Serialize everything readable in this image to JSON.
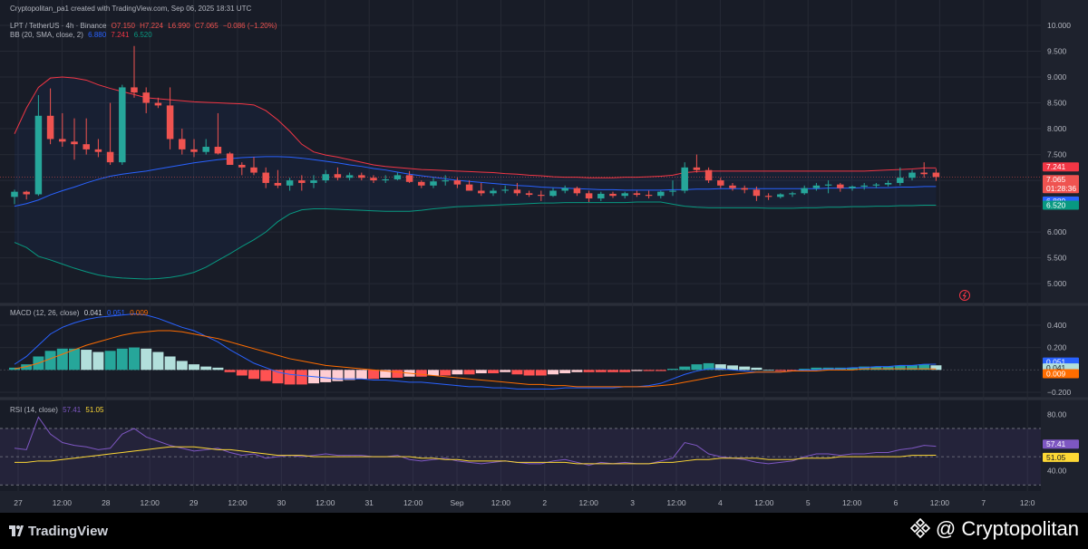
{
  "header": {
    "credit": "Cryptopolitan_pa1 created with TradingView.com, Sep 06, 2025 18:31 UTC",
    "symbol": "LPT / TetherUS · 4h · Binance",
    "ohlc": {
      "open": "O7.150",
      "high": "H7.224",
      "low": "L6.990",
      "close": "C7.065",
      "change": "−0.086 (−1.20%)"
    },
    "bb_label": "BB (20, SMA, close, 2)",
    "bb_values": [
      "6.880",
      "7.241",
      "6.520"
    ],
    "macd_label": "MACD (12, 26, close)",
    "macd_values": [
      "0.041",
      "0.051",
      "0.009"
    ],
    "rsi_label": "RSI (14, close)",
    "rsi_values": [
      "57.41",
      "51.05"
    ]
  },
  "badges": {
    "price_upper": "7.241",
    "price_last": "7.065",
    "countdown": "01:28:36",
    "price_mid": "6.880",
    "price_lower": "6.520",
    "macd_signal": "0.051",
    "macd_value": "0.041",
    "macd_hist": "0.009",
    "rsi_value": "57.41",
    "rsi_ma": "51.05"
  },
  "footer": {
    "brand": "TradingView",
    "watermark": "@ Cryptopolitan"
  },
  "colors": {
    "up": "#26a69a",
    "down": "#ef5350",
    "bb_upper": "#f23645",
    "bb_basis": "#2962ff",
    "bb_lower": "#089981",
    "macd_line": "#2962ff",
    "macd_signal": "#ff6d00",
    "rsi_line": "#7e57c2",
    "rsi_ma": "#fdd835"
  },
  "chart_data": [
    {
      "type": "candlestick",
      "x_ticks": [
        "27",
        "12:00",
        "28",
        "12:00",
        "29",
        "12:00",
        "30",
        "12:00",
        "31",
        "12:00",
        "Sep",
        "12:00",
        "2",
        "12:00",
        "3",
        "12:00",
        "4",
        "12:00",
        "5",
        "12:00",
        "6",
        "12:00",
        "7",
        "12:0"
      ],
      "y_ticks": [
        "10.000",
        "9.500",
        "9.000",
        "8.500",
        "8.000",
        "7.500",
        "7.000",
        "6.500",
        "6.000",
        "5.500",
        "5.000"
      ],
      "ylim": [
        4.95,
        10.0
      ],
      "ohlc": [
        [
          6.68,
          6.82,
          6.54,
          6.78
        ],
        [
          6.78,
          6.8,
          6.63,
          6.73
        ],
        [
          6.73,
          8.65,
          6.7,
          8.25
        ],
        [
          8.25,
          8.78,
          7.7,
          7.8
        ],
        [
          7.8,
          8.3,
          7.65,
          7.75
        ],
        [
          7.75,
          8.2,
          7.4,
          7.7
        ],
        [
          7.7,
          8.2,
          7.5,
          7.6
        ],
        [
          7.6,
          7.8,
          7.45,
          7.55
        ],
        [
          7.55,
          8.5,
          7.3,
          7.35
        ],
        [
          7.35,
          8.85,
          7.3,
          8.8
        ],
        [
          8.8,
          9.6,
          8.6,
          8.7
        ],
        [
          8.7,
          8.8,
          8.3,
          8.5
        ],
        [
          8.5,
          8.6,
          8.4,
          8.45
        ],
        [
          8.45,
          8.8,
          7.6,
          7.8
        ],
        [
          7.8,
          8.0,
          7.5,
          7.6
        ],
        [
          7.6,
          7.8,
          7.45,
          7.55
        ],
        [
          7.55,
          7.8,
          7.5,
          7.65
        ],
        [
          7.65,
          8.3,
          7.5,
          7.52
        ],
        [
          7.52,
          7.55,
          7.3,
          7.3
        ],
        [
          7.3,
          7.35,
          7.1,
          7.25
        ],
        [
          7.25,
          7.45,
          7.1,
          7.15
        ],
        [
          7.15,
          7.25,
          6.85,
          6.95
        ],
        [
          6.95,
          7.2,
          6.85,
          6.9
        ],
        [
          6.9,
          7.05,
          6.8,
          7.0
        ],
        [
          7.0,
          7.1,
          6.8,
          6.95
        ],
        [
          6.95,
          7.1,
          6.85,
          7.0
        ],
        [
          7.0,
          7.2,
          6.95,
          7.12
        ],
        [
          7.12,
          7.25,
          7.0,
          7.05
        ],
        [
          7.05,
          7.15,
          7.0,
          7.1
        ],
        [
          7.1,
          7.15,
          7.0,
          7.05
        ],
        [
          7.05,
          7.1,
          6.95,
          7.0
        ],
        [
          7.0,
          7.1,
          6.95,
          7.02
        ],
        [
          7.02,
          7.15,
          7.0,
          7.1
        ],
        [
          7.1,
          7.18,
          6.95,
          6.97
        ],
        [
          6.97,
          7.0,
          6.85,
          6.9
        ],
        [
          6.9,
          7.05,
          6.85,
          6.98
        ],
        [
          6.98,
          7.1,
          6.9,
          7.0
        ],
        [
          7.0,
          7.05,
          6.85,
          6.92
        ],
        [
          6.92,
          7.0,
          6.8,
          6.8
        ],
        [
          6.8,
          6.95,
          6.7,
          6.75
        ],
        [
          6.75,
          6.85,
          6.7,
          6.8
        ],
        [
          6.8,
          6.9,
          6.75,
          6.82
        ],
        [
          6.82,
          6.95,
          6.7,
          6.75
        ],
        [
          6.75,
          6.8,
          6.68,
          6.72
        ],
        [
          6.72,
          6.8,
          6.6,
          6.7
        ],
        [
          6.7,
          6.85,
          6.68,
          6.8
        ],
        [
          6.8,
          6.9,
          6.75,
          6.85
        ],
        [
          6.85,
          6.88,
          6.7,
          6.75
        ],
        [
          6.75,
          6.8,
          6.58,
          6.65
        ],
        [
          6.65,
          6.78,
          6.6,
          6.74
        ],
        [
          6.74,
          6.78,
          6.66,
          6.7
        ],
        [
          6.7,
          6.78,
          6.65,
          6.75
        ],
        [
          6.75,
          6.8,
          6.68,
          6.72
        ],
        [
          6.72,
          6.8,
          6.65,
          6.7
        ],
        [
          6.7,
          6.8,
          6.65,
          6.78
        ],
        [
          6.78,
          7.0,
          6.7,
          6.8
        ],
        [
          6.8,
          7.35,
          6.75,
          7.25
        ],
        [
          7.25,
          7.5,
          7.15,
          7.2
        ],
        [
          7.2,
          7.25,
          6.95,
          7.0
        ],
        [
          7.0,
          7.05,
          6.85,
          6.9
        ],
        [
          6.9,
          6.95,
          6.8,
          6.85
        ],
        [
          6.85,
          6.9,
          6.75,
          6.82
        ],
        [
          6.82,
          6.88,
          6.6,
          6.7
        ],
        [
          6.7,
          6.75,
          6.62,
          6.68
        ],
        [
          6.68,
          6.75,
          6.65,
          6.73
        ],
        [
          6.73,
          6.78,
          6.68,
          6.75
        ],
        [
          6.75,
          6.9,
          6.72,
          6.85
        ],
        [
          6.85,
          6.95,
          6.8,
          6.9
        ],
        [
          6.9,
          7.0,
          6.75,
          6.92
        ],
        [
          6.92,
          6.95,
          6.78,
          6.85
        ],
        [
          6.85,
          6.9,
          6.8,
          6.88
        ],
        [
          6.88,
          6.95,
          6.82,
          6.9
        ],
        [
          6.9,
          6.95,
          6.85,
          6.92
        ],
        [
          6.92,
          7.0,
          6.88,
          6.95
        ],
        [
          6.95,
          7.25,
          6.9,
          7.05
        ],
        [
          7.05,
          7.2,
          7.0,
          7.15
        ],
        [
          7.15,
          7.35,
          7.05,
          7.12
        ],
        [
          7.15,
          7.224,
          6.99,
          7.065
        ]
      ],
      "bb_upper": [
        7.9,
        8.4,
        8.8,
        8.98,
        9.0,
        8.98,
        8.94,
        8.85,
        8.78,
        8.72,
        8.66,
        8.6,
        8.58,
        8.56,
        8.54,
        8.52,
        8.51,
        8.5,
        8.49,
        8.48,
        8.46,
        8.35,
        8.17,
        7.95,
        7.7,
        7.55,
        7.49,
        7.45,
        7.4,
        7.35,
        7.3,
        7.27,
        7.25,
        7.23,
        7.21,
        7.2,
        7.19,
        7.18,
        7.17,
        7.16,
        7.15,
        7.13,
        7.12,
        7.1,
        7.09,
        7.07,
        7.06,
        7.06,
        7.05,
        7.05,
        7.05,
        7.06,
        7.06,
        7.07,
        7.08,
        7.1,
        7.15,
        7.17,
        7.18,
        7.18,
        7.18,
        7.18,
        7.18,
        7.18,
        7.18,
        7.18,
        7.18,
        7.18,
        7.18,
        7.18,
        7.18,
        7.18,
        7.19,
        7.2,
        7.21,
        7.22,
        7.24,
        7.241
      ],
      "bb_basis": [
        6.5,
        6.55,
        6.62,
        6.72,
        6.8,
        6.87,
        6.95,
        7.02,
        7.08,
        7.12,
        7.15,
        7.18,
        7.22,
        7.26,
        7.3,
        7.34,
        7.37,
        7.4,
        7.42,
        7.44,
        7.45,
        7.46,
        7.46,
        7.45,
        7.43,
        7.4,
        7.37,
        7.34,
        7.3,
        7.27,
        7.23,
        7.2,
        7.16,
        7.12,
        7.09,
        7.06,
        7.03,
        7.0,
        6.98,
        6.96,
        6.94,
        6.92,
        6.9,
        6.89,
        6.87,
        6.86,
        6.85,
        6.84,
        6.83,
        6.82,
        6.82,
        6.81,
        6.81,
        6.81,
        6.81,
        6.82,
        6.82,
        6.83,
        6.83,
        6.84,
        6.84,
        6.84,
        6.84,
        6.84,
        6.84,
        6.84,
        6.84,
        6.84,
        6.85,
        6.85,
        6.85,
        6.86,
        6.86,
        6.86,
        6.87,
        6.87,
        6.88,
        6.88
      ],
      "bb_lower": [
        5.8,
        5.7,
        5.53,
        5.46,
        5.38,
        5.3,
        5.23,
        5.17,
        5.13,
        5.11,
        5.1,
        5.09,
        5.1,
        5.12,
        5.16,
        5.22,
        5.32,
        5.45,
        5.58,
        5.72,
        5.85,
        6.0,
        6.2,
        6.35,
        6.43,
        6.45,
        6.45,
        6.44,
        6.43,
        6.42,
        6.41,
        6.4,
        6.4,
        6.4,
        6.42,
        6.45,
        6.47,
        6.49,
        6.5,
        6.51,
        6.52,
        6.53,
        6.54,
        6.55,
        6.56,
        6.56,
        6.57,
        6.57,
        6.57,
        6.57,
        6.57,
        6.57,
        6.58,
        6.58,
        6.58,
        6.54,
        6.5,
        6.48,
        6.47,
        6.47,
        6.47,
        6.47,
        6.47,
        6.46,
        6.46,
        6.46,
        6.47,
        6.47,
        6.48,
        6.48,
        6.49,
        6.49,
        6.5,
        6.5,
        6.51,
        6.51,
        6.52,
        6.52
      ]
    },
    {
      "type": "macd",
      "y_ticks": [
        "0.400",
        "0.200",
        "−0.200"
      ],
      "ylim": [
        -0.24,
        0.52
      ],
      "histogram": [
        0.02,
        0.05,
        0.12,
        0.17,
        0.19,
        0.19,
        0.18,
        0.16,
        0.17,
        0.19,
        0.2,
        0.19,
        0.16,
        0.12,
        0.08,
        0.05,
        0.03,
        0.02,
        -0.02,
        -0.05,
        -0.08,
        -0.1,
        -0.12,
        -0.13,
        -0.13,
        -0.12,
        -0.11,
        -0.1,
        -0.09,
        -0.08,
        -0.08,
        -0.07,
        -0.07,
        -0.06,
        -0.06,
        -0.05,
        -0.05,
        -0.04,
        -0.04,
        -0.03,
        -0.03,
        -0.02,
        -0.04,
        -0.05,
        -0.05,
        -0.04,
        -0.03,
        -0.02,
        -0.02,
        -0.02,
        -0.02,
        -0.02,
        -0.01,
        -0.01,
        -0.01,
        0.01,
        0.03,
        0.05,
        0.06,
        0.05,
        0.04,
        0.03,
        0.02,
        0.0,
        -0.01,
        -0.01,
        0.01,
        0.02,
        0.02,
        0.02,
        0.02,
        0.03,
        0.03,
        0.03,
        0.04,
        0.04,
        0.05,
        0.041
      ],
      "macd": [
        0.05,
        0.12,
        0.22,
        0.32,
        0.38,
        0.42,
        0.45,
        0.47,
        0.48,
        0.49,
        0.5,
        0.49,
        0.46,
        0.42,
        0.38,
        0.35,
        0.3,
        0.25,
        0.18,
        0.12,
        0.06,
        0.02,
        -0.02,
        -0.04,
        -0.05,
        -0.06,
        -0.07,
        -0.08,
        -0.08,
        -0.08,
        -0.09,
        -0.09,
        -0.1,
        -0.11,
        -0.11,
        -0.12,
        -0.13,
        -0.14,
        -0.15,
        -0.15,
        -0.16,
        -0.16,
        -0.17,
        -0.17,
        -0.17,
        -0.17,
        -0.16,
        -0.16,
        -0.16,
        -0.16,
        -0.16,
        -0.15,
        -0.15,
        -0.14,
        -0.12,
        -0.08,
        -0.04,
        -0.01,
        0.01,
        0.01,
        0.0,
        -0.01,
        -0.02,
        -0.02,
        -0.02,
        -0.01,
        0.0,
        0.0,
        0.01,
        0.01,
        0.02,
        0.02,
        0.03,
        0.03,
        0.04,
        0.04,
        0.05,
        0.051
      ],
      "signal": [
        0.01,
        0.03,
        0.06,
        0.1,
        0.14,
        0.18,
        0.22,
        0.25,
        0.28,
        0.31,
        0.33,
        0.34,
        0.35,
        0.35,
        0.34,
        0.32,
        0.3,
        0.28,
        0.25,
        0.22,
        0.19,
        0.16,
        0.13,
        0.1,
        0.08,
        0.06,
        0.04,
        0.03,
        0.02,
        0.01,
        0.0,
        -0.01,
        -0.02,
        -0.03,
        -0.04,
        -0.05,
        -0.06,
        -0.07,
        -0.08,
        -0.09,
        -0.1,
        -0.11,
        -0.12,
        -0.13,
        -0.13,
        -0.14,
        -0.14,
        -0.15,
        -0.15,
        -0.15,
        -0.15,
        -0.15,
        -0.15,
        -0.15,
        -0.14,
        -0.13,
        -0.11,
        -0.09,
        -0.07,
        -0.05,
        -0.04,
        -0.03,
        -0.02,
        -0.02,
        -0.02,
        -0.01,
        -0.01,
        -0.01,
        0.0,
        0.0,
        0.0,
        0.01,
        0.01,
        0.01,
        0.01,
        0.01,
        0.01,
        0.009
      ]
    },
    {
      "type": "rsi",
      "y_ticks": [
        "80.00",
        "40.00"
      ],
      "ylim": [
        27,
        86
      ],
      "bands": [
        70,
        50,
        30
      ],
      "rsi": [
        56,
        55,
        78,
        66,
        60,
        58,
        57,
        55,
        56,
        66,
        70,
        64,
        61,
        58,
        56,
        54,
        55,
        56,
        53,
        51,
        52,
        49,
        50,
        51,
        50,
        51,
        52,
        51,
        51,
        51,
        50,
        50,
        51,
        48,
        47,
        48,
        49,
        47,
        46,
        45,
        46,
        47,
        46,
        45,
        45,
        47,
        48,
        46,
        44,
        46,
        45,
        46,
        45,
        45,
        47,
        49,
        60,
        58,
        52,
        50,
        49,
        48,
        46,
        45,
        46,
        47,
        50,
        52,
        52,
        51,
        52,
        52,
        53,
        53,
        55,
        56,
        58,
        57.41
      ],
      "ma": [
        46,
        46,
        47,
        47,
        48,
        49,
        50,
        51,
        52,
        53,
        54,
        55,
        56,
        57,
        57,
        57,
        56,
        55,
        55,
        54,
        53,
        52,
        51,
        51,
        51,
        50,
        50,
        50,
        50,
        50,
        50,
        50,
        50,
        50,
        49,
        49,
        48,
        48,
        47,
        47,
        47,
        47,
        46,
        46,
        46,
        46,
        46,
        45,
        45,
        45,
        45,
        45,
        45,
        45,
        46,
        46,
        47,
        48,
        48,
        49,
        49,
        49,
        49,
        48,
        48,
        48,
        49,
        49,
        49,
        50,
        50,
        50,
        50,
        50,
        50,
        51,
        51,
        51.05
      ]
    }
  ]
}
